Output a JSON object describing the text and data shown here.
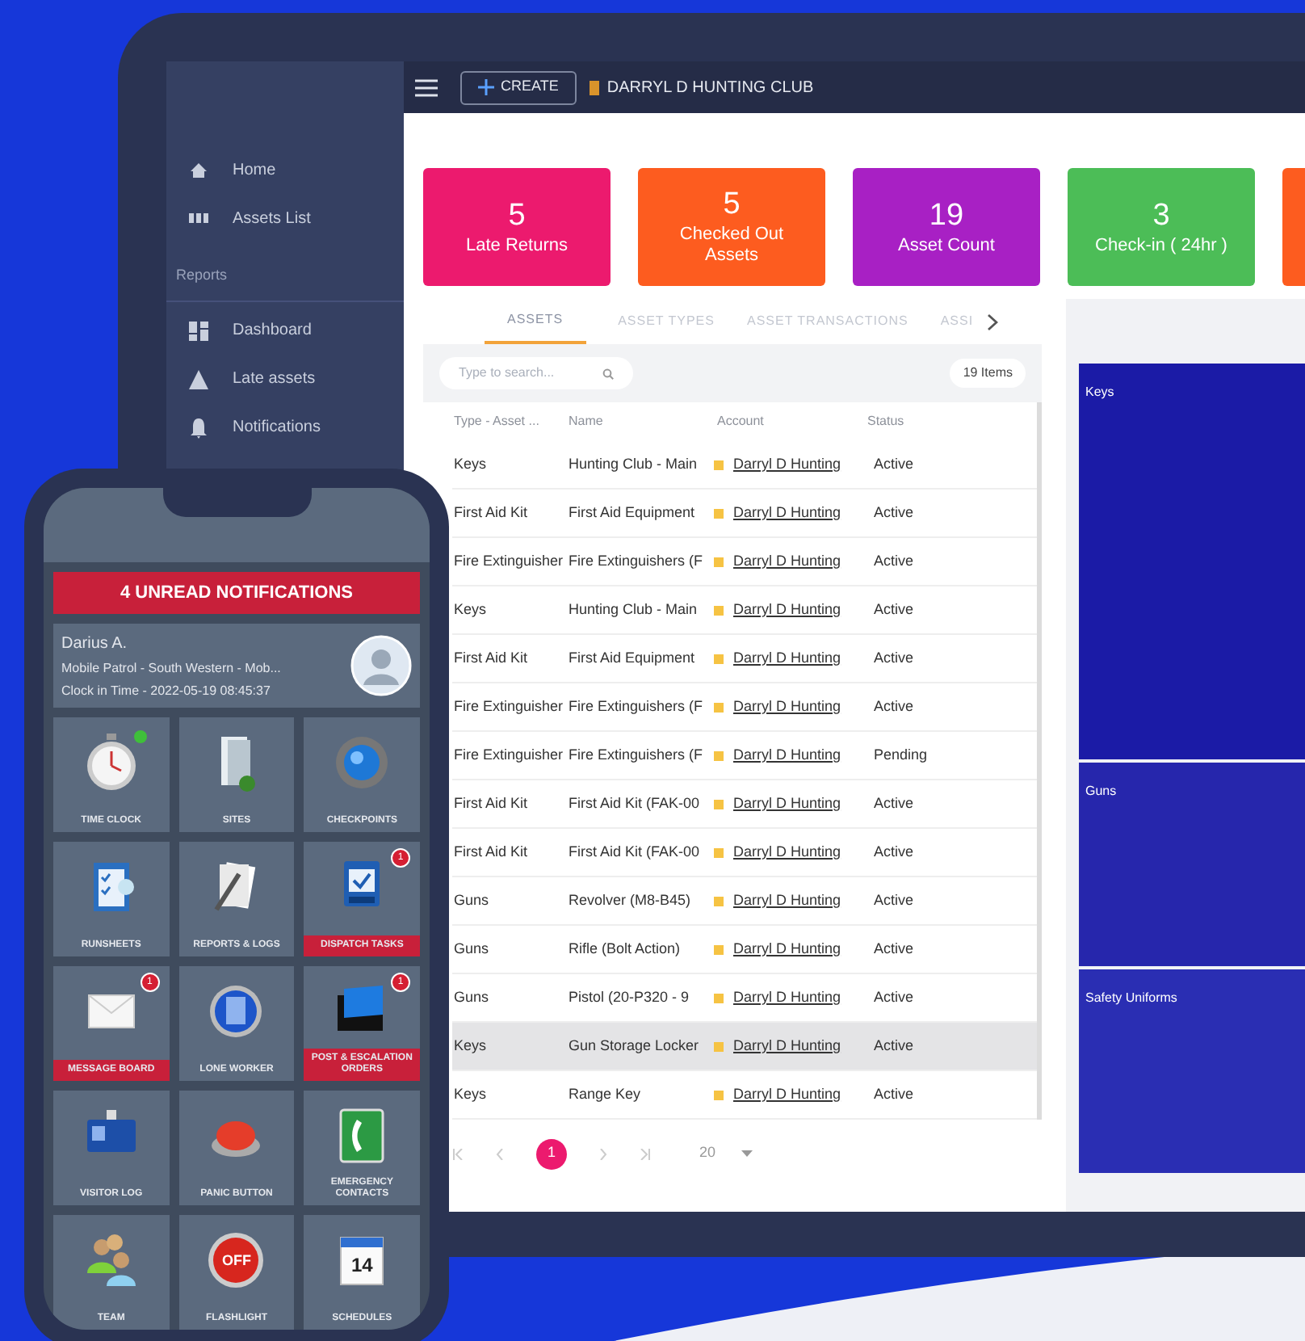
{
  "top_bar": {
    "create_button": "CREATE",
    "account": "DARRYL D HUNTING CLUB"
  },
  "sidebar": {
    "items": [
      {
        "label": "Home",
        "kind": "home"
      },
      {
        "label": "Assets List",
        "kind": "list"
      }
    ],
    "sections": [
      {
        "title": "Reports",
        "items": [
          {
            "label": "Dashboard",
            "kind": "dashboard"
          },
          {
            "label": "Late assets",
            "kind": "warning"
          },
          {
            "label": "Notifications",
            "kind": "bell"
          }
        ]
      }
    ]
  },
  "stat_cards": [
    {
      "value": "5",
      "label": "Late Returns",
      "color": "#ec1a6e"
    },
    {
      "value": "5",
      "label": "Checked Out Assets",
      "color": "#fd5c1f"
    },
    {
      "value": "19",
      "label": "Asset Count",
      "color": "#a820c4"
    },
    {
      "value": "3",
      "label": "Check-in ( 24hr )",
      "color": "#4cbd57"
    }
  ],
  "tabs": [
    {
      "label": "ASSETS",
      "selected": true
    },
    {
      "label": "ASSET TYPES",
      "selected": false
    },
    {
      "label": "ASSET TRANSACTIONS",
      "selected": false
    },
    {
      "label": "ASSI",
      "selected": false
    }
  ],
  "search": {
    "placeholder": "Type to search..."
  },
  "item_count": "19 Items",
  "table": {
    "columns": [
      "Type - Asset ...",
      "Name",
      "Account",
      "Status"
    ],
    "rows": [
      {
        "cells": [
          "Keys",
          "Hunting Club - Main",
          "Darryl D Hunting",
          "Active"
        ],
        "selected": false
      },
      {
        "cells": [
          "First Aid Kit",
          "First Aid Equipment",
          "Darryl D Hunting",
          "Active"
        ],
        "selected": false
      },
      {
        "cells": [
          "Fire Extinguisher",
          "Fire Extinguishers (F",
          "Darryl D Hunting",
          "Active"
        ],
        "selected": false
      },
      {
        "cells": [
          "Keys",
          "Hunting Club - Main",
          "Darryl D Hunting",
          "Active"
        ],
        "selected": false
      },
      {
        "cells": [
          "First Aid Kit",
          "First Aid Equipment",
          "Darryl D Hunting",
          "Active"
        ],
        "selected": false
      },
      {
        "cells": [
          "Fire Extinguisher",
          "Fire Extinguishers (F",
          "Darryl D Hunting",
          "Active"
        ],
        "selected": false
      },
      {
        "cells": [
          "Fire Extinguisher",
          "Fire Extinguishers (F",
          "Darryl D Hunting",
          "Pending"
        ],
        "selected": false
      },
      {
        "cells": [
          "First Aid Kit",
          "First Aid Kit (FAK-00",
          "Darryl D Hunting",
          "Active"
        ],
        "selected": false
      },
      {
        "cells": [
          "First Aid Kit",
          "First Aid Kit (FAK-00",
          "Darryl D Hunting",
          "Active"
        ],
        "selected": false
      },
      {
        "cells": [
          "Guns",
          "Revolver (M8-B45)",
          "Darryl D Hunting",
          "Active"
        ],
        "selected": false
      },
      {
        "cells": [
          "Guns",
          "Rifle (Bolt Action)",
          "Darryl D Hunting",
          "Active"
        ],
        "selected": false
      },
      {
        "cells": [
          "Guns",
          "Pistol (20-P320 - 9",
          "Darryl D Hunting",
          "Active"
        ],
        "selected": false
      },
      {
        "cells": [
          "Keys",
          "Gun Storage Locker",
          "Darryl D Hunting",
          "Active"
        ],
        "selected": true
      },
      {
        "cells": [
          "Keys",
          "Range Key",
          "Darryl D Hunting",
          "Active"
        ],
        "selected": false
      }
    ]
  },
  "pagination": {
    "pages": [
      {
        "label": "1",
        "selected": true
      }
    ],
    "page_size": "20"
  },
  "treemap": [
    {
      "label": "Keys",
      "color": "#1b1ba6"
    },
    {
      "label": "Guns",
      "color": "#2626ac"
    },
    {
      "label": "Safety Uniforms",
      "color": "#2a2eb3"
    }
  ],
  "phone": {
    "notification_bar": "4 UNREAD NOTIFICATIONS",
    "profile": {
      "name": "Darius A.",
      "detail": "Mobile Patrol - South Western - Mob...",
      "clock_in": "Clock in Time - 2022-05-19 08:45:37"
    },
    "tiles": [
      {
        "label": "TIME CLOCK",
        "kind": "clock",
        "alert": false,
        "online": true
      },
      {
        "label": "SITES",
        "kind": "sites",
        "alert": false,
        "online": false
      },
      {
        "label": "CHECKPOINTS",
        "kind": "checkpoint",
        "alert": false,
        "online": false
      },
      {
        "label": "RUNSHEETS",
        "kind": "runsheet",
        "alert": false,
        "online": false
      },
      {
        "label": "REPORTS & LOGS",
        "kind": "reports",
        "alert": false,
        "online": false
      },
      {
        "label": "DISPATCH TASKS",
        "kind": "dispatch",
        "alert": true,
        "online": false,
        "badge": "1"
      },
      {
        "label": "MESSAGE BOARD",
        "kind": "message",
        "alert": true,
        "online": false,
        "badge": "1"
      },
      {
        "label": "LONE WORKER",
        "kind": "worker",
        "alert": false,
        "online": false
      },
      {
        "label": "POST & ESCALATION ORDERS",
        "kind": "folder",
        "alert": true,
        "online": false,
        "badge": "1"
      },
      {
        "label": "VISITOR LOG",
        "kind": "visitor",
        "alert": false,
        "online": false
      },
      {
        "label": "PANIC BUTTON",
        "kind": "panic",
        "alert": false,
        "online": false
      },
      {
        "label": "EMERGENCY CONTACTS",
        "kind": "phone",
        "alert": false,
        "online": false
      },
      {
        "label": "TEAM",
        "kind": "team",
        "alert": false,
        "online": false
      },
      {
        "label": "FLASHLIGHT",
        "kind": "flashlight",
        "alert": false,
        "online": false,
        "icon_text": "OFF"
      },
      {
        "label": "SCHEDULES",
        "kind": "calendar",
        "alert": false,
        "online": false,
        "icon_text": "14"
      }
    ]
  }
}
